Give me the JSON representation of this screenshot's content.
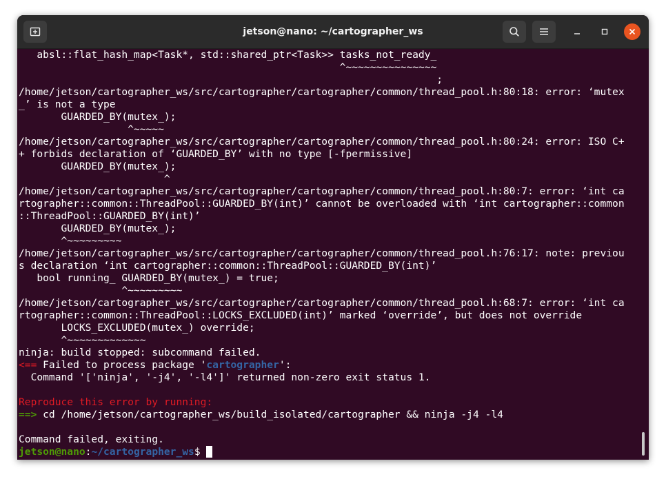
{
  "window": {
    "title": "jetson@nano: ~/cartographer_ws"
  },
  "icons": {
    "new_tab": "new-tab-icon",
    "search": "search-icon",
    "menu": "hamburger-menu-icon",
    "minimize": "minimize-icon",
    "maximize": "maximize-icon",
    "close": "close-icon"
  },
  "colors": {
    "terminal_bg": "#300a24",
    "titlebar_bg": "#2b2b2b",
    "close_button": "#e95420",
    "error_red": "#e01b24",
    "prompt_green": "#4e9a06",
    "path_blue": "#3465a4"
  },
  "terminal": {
    "lines": [
      "   absl::flat_hash_map<Task*, std::shared_ptr<Task>> tasks_not_ready_",
      "                                                     ^~~~~~~~~~~~~~~~",
      "                                                                     ;",
      "/home/jetson/cartographer_ws/src/cartographer/cartographer/common/thread_pool.h:80:18: error: ‘mutex",
      "_’ is not a type",
      "       GUARDED_BY(mutex_);",
      "                  ^~~~~~",
      "/home/jetson/cartographer_ws/src/cartographer/cartographer/common/thread_pool.h:80:24: error: ISO C+",
      "+ forbids declaration of ‘GUARDED_BY’ with no type [-fpermissive]",
      "       GUARDED_BY(mutex_);",
      "                        ^",
      "/home/jetson/cartographer_ws/src/cartographer/cartographer/common/thread_pool.h:80:7: error: ‘int ca",
      "rtographer::common::ThreadPool::GUARDED_BY(int)’ cannot be overloaded with ‘int cartographer::common",
      "::ThreadPool::GUARDED_BY(int)’",
      "       GUARDED_BY(mutex_);",
      "       ^~~~~~~~~~",
      "/home/jetson/cartographer_ws/src/cartographer/cartographer/common/thread_pool.h:76:17: note: previou",
      "s declaration ‘int cartographer::common::ThreadPool::GUARDED_BY(int)’",
      "   bool running_ GUARDED_BY(mutex_) = true;",
      "                 ^~~~~~~~~~",
      "/home/jetson/cartographer_ws/src/cartographer/cartographer/common/thread_pool.h:68:7: error: ‘int ca",
      "rtographer::common::ThreadPool::LOCKS_EXCLUDED(int)’ marked ‘override’, but does not override",
      "       LOCKS_EXCLUDED(mutex_) override;",
      "       ^~~~~~~~~~~~~~",
      "ninja: build stopped: subcommand failed."
    ],
    "failed_prefix": "<==",
    "failed_text": " Failed to process package '",
    "failed_pkg": "cartographer",
    "failed_suffix": "':",
    "command_line": "  Command '['ninja', '-j4', '-l4']' returned non-zero exit status 1.",
    "reproduce": "Reproduce this error by running:",
    "cd_prefix": "==>",
    "cd_command": " cd /home/jetson/cartographer_ws/build_isolated/cartographer && ninja -j4 -l4",
    "exiting": "Command failed, exiting.",
    "prompt_user": "jetson@nano",
    "prompt_colon": ":",
    "prompt_path": "~/cartographer_ws",
    "prompt_dollar": "$ "
  }
}
